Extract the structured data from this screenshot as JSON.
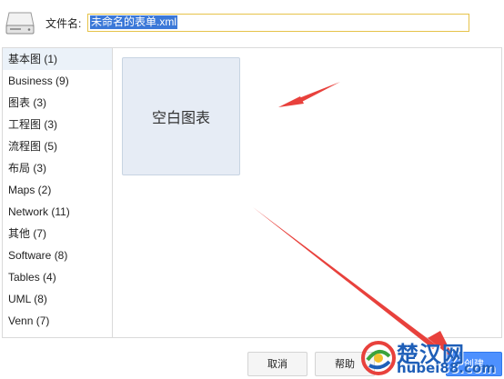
{
  "header": {
    "label": "文件名:",
    "filename": "未命名的表单.xml"
  },
  "sidebar": {
    "selected_index": 0,
    "items": [
      {
        "label": "基本图 (1)"
      },
      {
        "label": "Business (9)"
      },
      {
        "label": "图表 (3)"
      },
      {
        "label": "工程图 (3)"
      },
      {
        "label": "流程图 (5)"
      },
      {
        "label": "布局 (3)"
      },
      {
        "label": "Maps (2)"
      },
      {
        "label": "Network (11)"
      },
      {
        "label": "其他 (7)"
      },
      {
        "label": "Software (8)"
      },
      {
        "label": "Tables (4)"
      },
      {
        "label": "UML (8)"
      },
      {
        "label": "Venn (7)"
      }
    ]
  },
  "templates": [
    {
      "label": "空白图表"
    }
  ],
  "buttons": {
    "cancel": "取消",
    "help": "帮助",
    "create": "创建"
  },
  "watermark": {
    "title": "楚汉网",
    "domain": "hubei88.com"
  },
  "colors": {
    "arrow": "#e8413c",
    "selection": "#3b78d8",
    "sidebar_selected": "#ebf2f9",
    "card_bg": "#e6ecf5",
    "watermark": "#1f5fb8"
  },
  "icons": {
    "drive": "hard-drive-icon"
  }
}
